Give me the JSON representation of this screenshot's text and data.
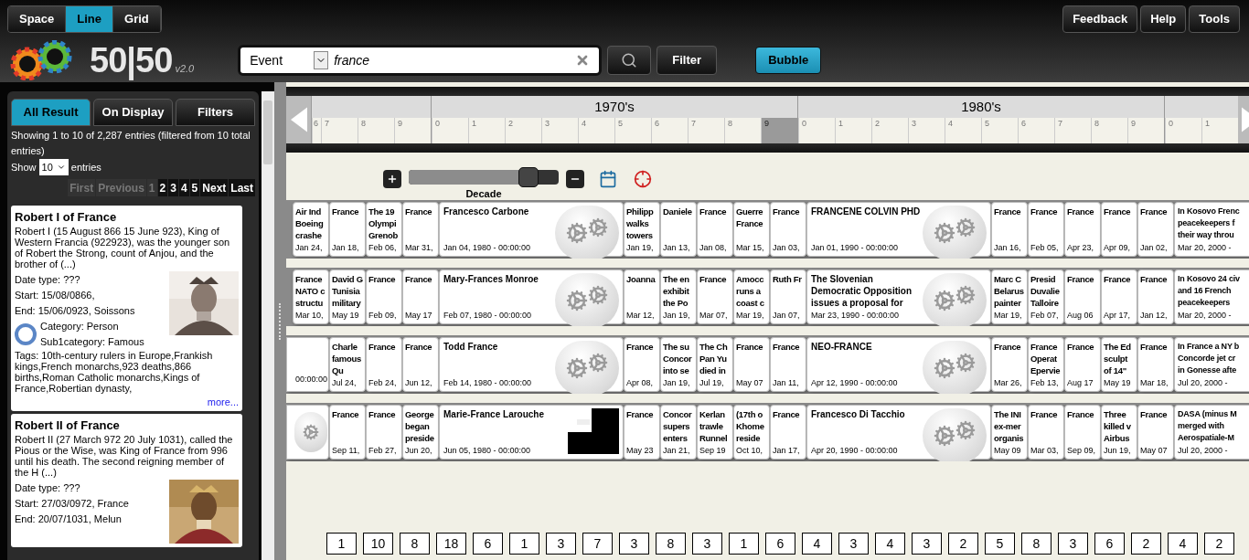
{
  "view_modes": [
    {
      "label": "Space",
      "selected": false
    },
    {
      "label": "Line",
      "selected": true
    },
    {
      "label": "Grid",
      "selected": false
    }
  ],
  "top_buttons": [
    "Feedback",
    "Help",
    "Tools"
  ],
  "logo": {
    "text": "50|50",
    "version": "v2.0"
  },
  "search": {
    "type": "Event",
    "query": "france"
  },
  "filter_button": "Filter",
  "bubble_button": "Bubble",
  "results_panel": {
    "tabs": [
      {
        "label": "All Result",
        "selected": true
      },
      {
        "label": "On Display",
        "selected": false
      },
      {
        "label": "Filters",
        "selected": false
      }
    ],
    "info": "Showing 1 to 10 of 2,287 entries (filtered from 10 total entries)",
    "show_label": "Show",
    "page_size": "10",
    "entries_label": "entries",
    "pagination": [
      {
        "label": "First",
        "disabled": true
      },
      {
        "label": "Previous",
        "disabled": true
      },
      {
        "label": "1",
        "disabled": true
      },
      {
        "label": "2",
        "disabled": false
      },
      {
        "label": "3",
        "disabled": false
      },
      {
        "label": "4",
        "disabled": false
      },
      {
        "label": "5",
        "disabled": false
      },
      {
        "label": "Next",
        "disabled": false
      },
      {
        "label": "Last",
        "disabled": false
      }
    ],
    "results": [
      {
        "title": "Robert I of France",
        "summary": "Robert I (15 August 866 15 June 923), King of Western Francia (922923), was the younger son of Robert the Strong, count of Anjou, and the brother of (...)",
        "date_type": "Date type: ???",
        "start": "Start: 15/08/0866,",
        "end": "End: 15/06/0923, Soissons",
        "category": "Category: Person",
        "subcategory": "Sub1category: Famous",
        "tags": "Tags: 10th-century rulers in Europe,Frankish kings,French monarchs,923 deaths,866 births,Roman Catholic monarchs,Kings of France,Robertian dynasty,",
        "more": "more..."
      },
      {
        "title": "Robert II of France",
        "summary": "Robert II (27 March 972 20 July 1031), called the Pious or the Wise, was King of France from 996 until his death. The second reigning member of the H (...)",
        "date_type": "Date type: ???",
        "start": "Start: 27/03/0972, France",
        "end": "End: 20/07/1031, Melun"
      }
    ]
  },
  "timeline": {
    "decades": [
      {
        "years": [
          {
            "label": "6",
            "selected": false
          },
          {
            "label": "7",
            "selected": false
          },
          {
            "label": "8",
            "selected": false
          },
          {
            "label": "9",
            "selected": false
          }
        ]
      },
      {
        "label": "1970's",
        "years": [
          {
            "label": "0",
            "selected": false
          },
          {
            "label": "1",
            "selected": false
          },
          {
            "label": "2",
            "selected": false
          },
          {
            "label": "3",
            "selected": false
          },
          {
            "label": "4",
            "selected": false
          },
          {
            "label": "5",
            "selected": false
          },
          {
            "label": "6",
            "selected": false
          },
          {
            "label": "7",
            "selected": false
          },
          {
            "label": "8",
            "selected": false
          },
          {
            "label": "9",
            "selected": true
          }
        ]
      },
      {
        "label": "1980's",
        "years": [
          {
            "label": "0",
            "selected": false
          },
          {
            "label": "1",
            "selected": false
          },
          {
            "label": "2",
            "selected": false
          },
          {
            "label": "3",
            "selected": false
          },
          {
            "label": "4",
            "selected": false
          },
          {
            "label": "5",
            "selected": false
          },
          {
            "label": "6",
            "selected": false
          },
          {
            "label": "7",
            "selected": false
          },
          {
            "label": "8",
            "selected": false
          },
          {
            "label": "9",
            "selected": false
          }
        ]
      },
      {
        "years": [
          {
            "label": "0",
            "selected": false
          },
          {
            "label": "1",
            "selected": false
          }
        ]
      }
    ]
  },
  "zoom": {
    "level": 0.8,
    "label": "Decade"
  },
  "rows": [
    {
      "cards": [
        {
          "kind": "small",
          "title": [
            "Air Ind",
            "Boeing",
            "crashe"
          ],
          "date": "Jan 24,"
        },
        {
          "kind": "small",
          "title": [
            "France"
          ],
          "date": "Jan 18,"
        },
        {
          "kind": "small",
          "title": [
            "The 19",
            "Olympi",
            "Grenob"
          ],
          "date": "Feb 06,"
        },
        {
          "kind": "small",
          "title": [
            "France"
          ],
          "date": "Mar 31,"
        },
        {
          "kind": "featured",
          "thumb": {
            "kind": "gears"
          },
          "title": [
            "Francesco Carbone"
          ],
          "date": "Jan 04, 1980 - 00:00:00"
        },
        {
          "kind": "small",
          "title": [
            "Philipp",
            "walks",
            "towers"
          ],
          "date": "Jan 19,"
        },
        {
          "kind": "small",
          "title": [
            "Daniele"
          ],
          "date": "Jan 13,"
        },
        {
          "kind": "small",
          "title": [
            "France"
          ],
          "date": "Jan 08,"
        },
        {
          "kind": "small",
          "title": [
            "Guerre",
            "France"
          ],
          "date": "Mar 15,"
        },
        {
          "kind": "small",
          "title": [
            "France"
          ],
          "date": "Jan 03,"
        },
        {
          "kind": "featured",
          "thumb": {
            "kind": "gears"
          },
          "title": [
            "FRANCENE COLVIN PHD"
          ],
          "date": "Jan 01, 1990 - 00:00:00"
        },
        {
          "kind": "small",
          "title": [
            "France"
          ],
          "date": "Jan 16,"
        },
        {
          "kind": "small",
          "title": [
            "France"
          ],
          "date": "Feb 05,"
        },
        {
          "kind": "small",
          "title": [
            "France"
          ],
          "date": "Apr 23,"
        },
        {
          "kind": "small",
          "title": [
            "France"
          ],
          "date": "Apr 09,"
        },
        {
          "kind": "small",
          "title": [
            "France"
          ],
          "date": "Jan 02,"
        },
        {
          "kind": "wide",
          "title": [
            "In Kosovo Frenc",
            "peacekeepers f",
            "their way throu"
          ],
          "date": "Mar 20, 2000 -"
        }
      ]
    },
    {
      "cards": [
        {
          "kind": "small",
          "title": [
            "France",
            "NATO c",
            "structu"
          ],
          "date": "Mar 10,"
        },
        {
          "kind": "small",
          "title": [
            "David G",
            "Tunisia",
            "military"
          ],
          "date": "May 19"
        },
        {
          "kind": "small",
          "title": [
            "France"
          ],
          "date": "Feb 09,"
        },
        {
          "kind": "small",
          "title": [
            "France"
          ],
          "date": "May 17"
        },
        {
          "kind": "featured",
          "thumb": {
            "kind": "gears"
          },
          "title": [
            "Mary-Frances Monroe"
          ],
          "date": "Feb 07, 1980 - 00:00:00"
        },
        {
          "kind": "small",
          "title": [
            "Joanna"
          ],
          "date": "Mar 12,"
        },
        {
          "kind": "small",
          "title": [
            "The en",
            "exhibit",
            "the Po"
          ],
          "date": "Jan 19,"
        },
        {
          "kind": "small",
          "title": [
            "France"
          ],
          "date": "Mar 07,"
        },
        {
          "kind": "small",
          "title": [
            "Amocc",
            "runs a",
            "coast c"
          ],
          "date": "Mar 19,"
        },
        {
          "kind": "small",
          "title": [
            "Ruth Fr"
          ],
          "date": "Jan 07,"
        },
        {
          "kind": "featured",
          "thumb": {
            "kind": "gears"
          },
          "title": [
            "The Slovenian",
            "Democratic Opposition",
            "issues a proposal for"
          ],
          "date": "Mar 23, 1990 - 00:00:00"
        },
        {
          "kind": "small",
          "title": [
            "Marc C",
            "Belarus",
            "painter"
          ],
          "date": "Mar 19,"
        },
        {
          "kind": "small",
          "title": [
            "Presid",
            "Duvalie",
            "Talloire"
          ],
          "date": "Feb 07,"
        },
        {
          "kind": "small",
          "title": [
            "France"
          ],
          "date": "Aug 06"
        },
        {
          "kind": "small",
          "title": [
            "France"
          ],
          "date": "Apr 17,"
        },
        {
          "kind": "small",
          "title": [
            "France"
          ],
          "date": "Jan 12,"
        },
        {
          "kind": "wide",
          "title": [
            "In Kosovo 24 civ",
            "and 16 French",
            "peacekeepers"
          ],
          "date": "Mar 20, 2000 -"
        }
      ]
    },
    {
      "cards": [
        {
          "kind": "cut",
          "date": "00:00:00"
        },
        {
          "kind": "small",
          "title": [
            "Charle",
            "famous",
            "Qu"
          ],
          "date": "Jul 24,"
        },
        {
          "kind": "small",
          "title": [
            "France"
          ],
          "date": "Feb 24,"
        },
        {
          "kind": "small",
          "title": [
            "France"
          ],
          "date": "Jun 12,"
        },
        {
          "kind": "featured",
          "thumb": {
            "kind": "gears"
          },
          "title": [
            "Todd France"
          ],
          "date": "Feb 14, 1980 - 00:00:00"
        },
        {
          "kind": "small",
          "title": [
            "France"
          ],
          "date": "Apr 08,"
        },
        {
          "kind": "small",
          "title": [
            "The su",
            "Concor",
            "into se"
          ],
          "date": "Jan 19,"
        },
        {
          "kind": "small",
          "title": [
            "The Ch",
            "Pan Yu",
            "died in"
          ],
          "date": "Jul 19,"
        },
        {
          "kind": "small",
          "title": [
            "France"
          ],
          "date": "May 07"
        },
        {
          "kind": "small",
          "title": [
            "France"
          ],
          "date": "Jan 11,"
        },
        {
          "kind": "featured",
          "thumb": {
            "kind": "gears"
          },
          "title": [
            "NEO-FRANCE"
          ],
          "date": "Apr 12, 1990 - 00:00:00"
        },
        {
          "kind": "small",
          "title": [
            "France"
          ],
          "date": "Mar 26,"
        },
        {
          "kind": "small",
          "title": [
            "France",
            "Operat",
            "Epervie"
          ],
          "date": "Feb 13,"
        },
        {
          "kind": "small",
          "title": [
            "France"
          ],
          "date": "Aug 17"
        },
        {
          "kind": "small",
          "title": [
            "The Ed",
            "sculpt",
            "of 14\""
          ],
          "date": "May 19"
        },
        {
          "kind": "small",
          "title": [
            "France"
          ],
          "date": "Mar 18,"
        },
        {
          "kind": "wide",
          "title": [
            "In France a NY b",
            "Concorde jet cr",
            "in Gonesse afte"
          ],
          "date": "Jul 20, 2000 -"
        }
      ]
    },
    {
      "cards": [
        {
          "kind": "cut",
          "thumb": {
            "kind": "gears"
          }
        },
        {
          "kind": "small",
          "title": [
            "France"
          ],
          "date": "Sep 11,"
        },
        {
          "kind": "small",
          "title": [
            "France"
          ],
          "date": "Feb 27,"
        },
        {
          "kind": "small",
          "title": [
            "George",
            "began",
            "preside"
          ],
          "date": "Jun 20,"
        },
        {
          "kind": "featured",
          "thumb": {
            "kind": "picture"
          },
          "title": [
            "Marie-France Larouche"
          ],
          "date": "Jun 05, 1980 - 00:00:00"
        },
        {
          "kind": "small",
          "title": [
            "France"
          ],
          "date": "May 23"
        },
        {
          "kind": "small",
          "title": [
            "Concor",
            "supers",
            "enters"
          ],
          "date": "Jan 21,"
        },
        {
          "kind": "small",
          "title": [
            "Kerlan",
            "trawle",
            "Runnel"
          ],
          "date": "Sep 19"
        },
        {
          "kind": "small",
          "title": [
            "(17th o",
            "Khome",
            "reside"
          ],
          "date": "Oct 10,"
        },
        {
          "kind": "small",
          "title": [
            "France"
          ],
          "date": "Jan 17,"
        },
        {
          "kind": "featured",
          "thumb": {
            "kind": "gears"
          },
          "title": [
            "Francesco Di Tacchio"
          ],
          "date": "Apr 20, 1990 - 00:00:00"
        },
        {
          "kind": "small",
          "title": [
            "The INI",
            "ex-mer",
            "organis"
          ],
          "date": "May 09"
        },
        {
          "kind": "small",
          "title": [
            "France"
          ],
          "date": "Mar 03,"
        },
        {
          "kind": "small",
          "title": [
            "France"
          ],
          "date": "Sep 09,"
        },
        {
          "kind": "small",
          "title": [
            "Three",
            "killed v",
            "Airbus"
          ],
          "date": "Jun 19,"
        },
        {
          "kind": "small",
          "title": [
            "France"
          ],
          "date": "May 07"
        },
        {
          "kind": "wide",
          "title": [
            "DASA (minus M",
            "merged with",
            "Aerospatiale-M"
          ],
          "date": "Jul 20, 2000 -"
        }
      ]
    }
  ],
  "counts": [
    "1",
    "10",
    "8",
    "18",
    "6",
    "1",
    "3",
    "7",
    "3",
    "8",
    "3",
    "1",
    "6",
    "4",
    "3",
    "4",
    "3",
    "2",
    "5",
    "8",
    "3",
    "6",
    "2",
    "4",
    "2"
  ]
}
